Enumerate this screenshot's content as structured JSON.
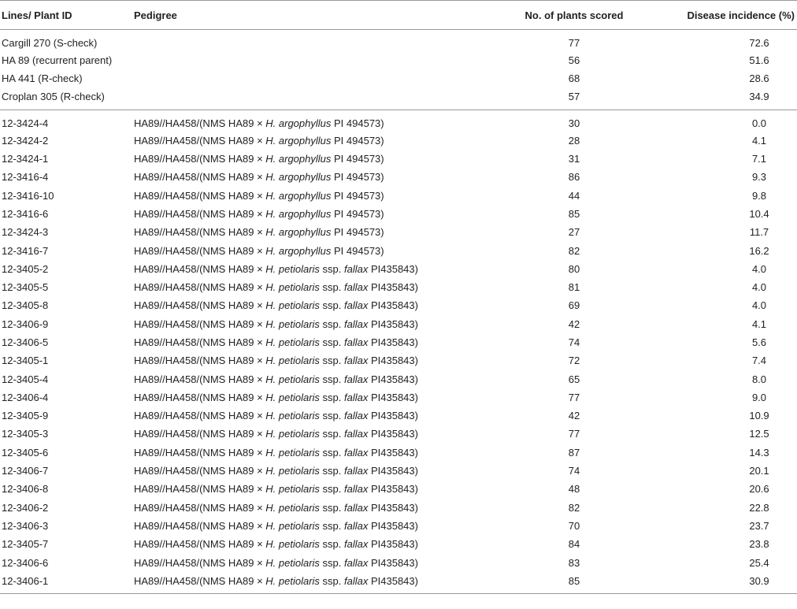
{
  "table": {
    "headers": {
      "line_id": "Lines/ Plant ID",
      "pedigree": "Pedigree",
      "plants_scored": "No. of plants scored",
      "disease_incidence": "Disease incidence (%)"
    },
    "checks": [
      {
        "id": "Cargill 270 (S-check)",
        "pedigree": "",
        "plants": "77",
        "incidence": "72.6"
      },
      {
        "id": "HA 89 (recurrent parent)",
        "pedigree": "",
        "plants": "56",
        "incidence": "51.6"
      },
      {
        "id": "HA 441 (R-check)",
        "pedigree": "",
        "plants": "68",
        "incidence": "28.6"
      },
      {
        "id": "Croplan 305 (R-check)",
        "pedigree": "",
        "plants": "57",
        "incidence": "34.9"
      }
    ],
    "pedigree_argophyllus": {
      "prefix": "HA89//HA458/(NMS HA89 × ",
      "species": "H. argophyllus",
      "suffix": " PI 494573)"
    },
    "pedigree_petiolaris": {
      "prefix": "HA89//HA458/(NMS HA89 × ",
      "species": "H. petiolaris",
      "middle": " ssp. ",
      "subspecies": "fallax",
      "suffix": " PI435843)"
    },
    "lines": [
      {
        "id": "12-3424-4",
        "type": "argophyllus",
        "plants": "30",
        "incidence": "0.0"
      },
      {
        "id": "12-3424-2",
        "type": "argophyllus",
        "plants": "28",
        "incidence": "4.1"
      },
      {
        "id": "12-3424-1",
        "type": "argophyllus",
        "plants": "31",
        "incidence": "7.1"
      },
      {
        "id": "12-3416-4",
        "type": "argophyllus",
        "plants": "86",
        "incidence": "9.3"
      },
      {
        "id": "12-3416-10",
        "type": "argophyllus",
        "plants": "44",
        "incidence": "9.8"
      },
      {
        "id": "12-3416-6",
        "type": "argophyllus",
        "plants": "85",
        "incidence": "10.4"
      },
      {
        "id": "12-3424-3",
        "type": "argophyllus",
        "plants": "27",
        "incidence": "11.7"
      },
      {
        "id": "12-3416-7",
        "type": "argophyllus",
        "plants": "82",
        "incidence": "16.2"
      },
      {
        "id": "12-3405-2",
        "type": "petiolaris",
        "plants": "80",
        "incidence": "4.0"
      },
      {
        "id": "12-3405-5",
        "type": "petiolaris",
        "plants": "81",
        "incidence": "4.0"
      },
      {
        "id": "12-3405-8",
        "type": "petiolaris",
        "plants": "69",
        "incidence": "4.0"
      },
      {
        "id": "12-3406-9",
        "type": "petiolaris",
        "plants": "42",
        "incidence": "4.1"
      },
      {
        "id": "12-3406-5",
        "type": "petiolaris",
        "plants": "74",
        "incidence": "5.6"
      },
      {
        "id": "12-3405-1",
        "type": "petiolaris",
        "plants": "72",
        "incidence": "7.4"
      },
      {
        "id": "12-3405-4",
        "type": "petiolaris",
        "plants": "65",
        "incidence": "8.0"
      },
      {
        "id": "12-3406-4",
        "type": "petiolaris",
        "plants": "77",
        "incidence": "9.0"
      },
      {
        "id": "12-3405-9",
        "type": "petiolaris",
        "plants": "42",
        "incidence": "10.9"
      },
      {
        "id": "12-3405-3",
        "type": "petiolaris",
        "plants": "77",
        "incidence": "12.5"
      },
      {
        "id": "12-3405-6",
        "type": "petiolaris",
        "plants": "87",
        "incidence": "14.3"
      },
      {
        "id": "12-3406-7",
        "type": "petiolaris",
        "plants": "74",
        "incidence": "20.1"
      },
      {
        "id": "12-3406-8",
        "type": "petiolaris",
        "plants": "48",
        "incidence": "20.6"
      },
      {
        "id": "12-3406-2",
        "type": "petiolaris",
        "plants": "82",
        "incidence": "22.8"
      },
      {
        "id": "12-3406-3",
        "type": "petiolaris",
        "plants": "70",
        "incidence": "23.7"
      },
      {
        "id": "12-3405-7",
        "type": "petiolaris",
        "plants": "84",
        "incidence": "23.8"
      },
      {
        "id": "12-3406-6",
        "type": "petiolaris",
        "plants": "83",
        "incidence": "25.4"
      },
      {
        "id": "12-3406-1",
        "type": "petiolaris",
        "plants": "85",
        "incidence": "30.9"
      }
    ]
  }
}
